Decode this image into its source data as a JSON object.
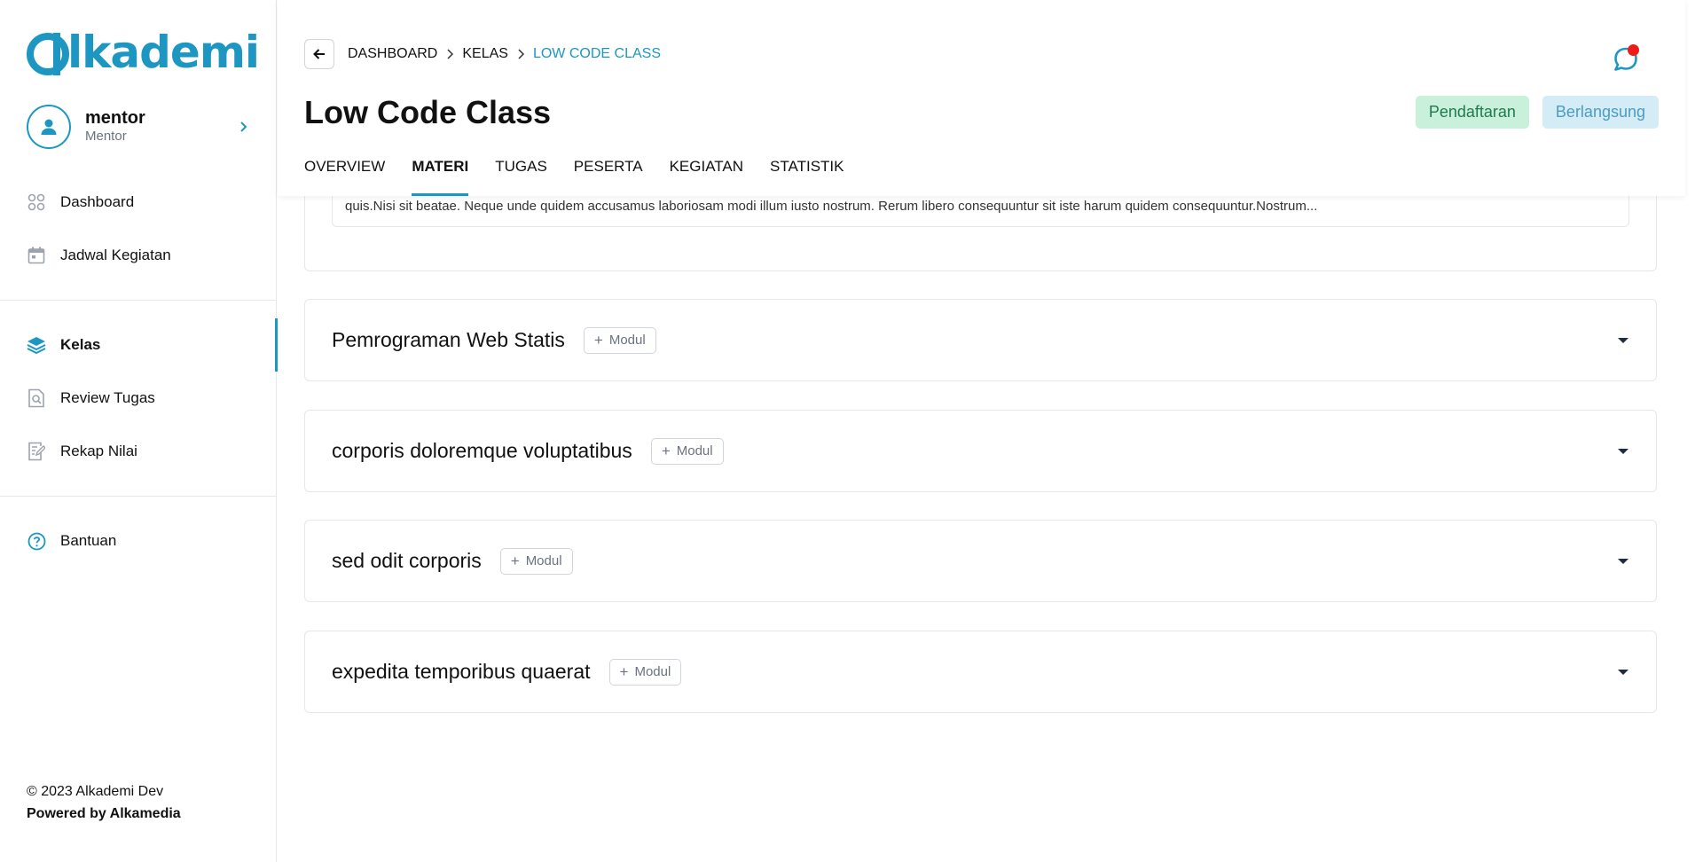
{
  "sidebar": {
    "logo_text": "lkademi",
    "user": {
      "name": "mentor",
      "role": "Mentor"
    },
    "nav_top": [
      {
        "label": "Dashboard",
        "icon": "grid-icon"
      },
      {
        "label": "Jadwal Kegiatan",
        "icon": "calendar-icon"
      }
    ],
    "nav_main": [
      {
        "label": "Kelas",
        "icon": "layers-icon",
        "active": true
      },
      {
        "label": "Review Tugas",
        "icon": "search-document-icon"
      },
      {
        "label": "Rekap Nilai",
        "icon": "edit-document-icon"
      }
    ],
    "nav_help": [
      {
        "label": "Bantuan",
        "icon": "help-circle-icon"
      }
    ],
    "footer": {
      "copyright": "© 2023 Alkademi Dev",
      "powered": "Powered by Alkamedia"
    }
  },
  "header": {
    "breadcrumb": [
      "DASHBOARD",
      "KELAS",
      "LOW CODE CLASS"
    ],
    "title": "Low Code Class",
    "badges": [
      "Pendaftaran",
      "Berlangsung"
    ],
    "tabs": [
      "OVERVIEW",
      "MATERI",
      "TUGAS",
      "PESERTA",
      "KEGIATAN",
      "STATISTIK"
    ],
    "active_tab": "MATERI"
  },
  "content": {
    "description_snippet": "quis.Nisi sit beatae. Neque unde quidem accusamus laboriosam modi illum iusto nostrum. Rerum libero consequuntur sit iste harum quidem consequuntur.Nostrum...",
    "modul_label": "Modul",
    "sections": [
      "Pemrograman Web Statis",
      "corporis doloremque voluptatibus",
      "sed odit corporis",
      "expedita temporibus quaerat"
    ]
  },
  "colors": {
    "accent": "#1d97c1",
    "badge_green_bg": "#c9f0db",
    "badge_blue_bg": "#d3ecf6",
    "notification": "#ef1b1b"
  }
}
